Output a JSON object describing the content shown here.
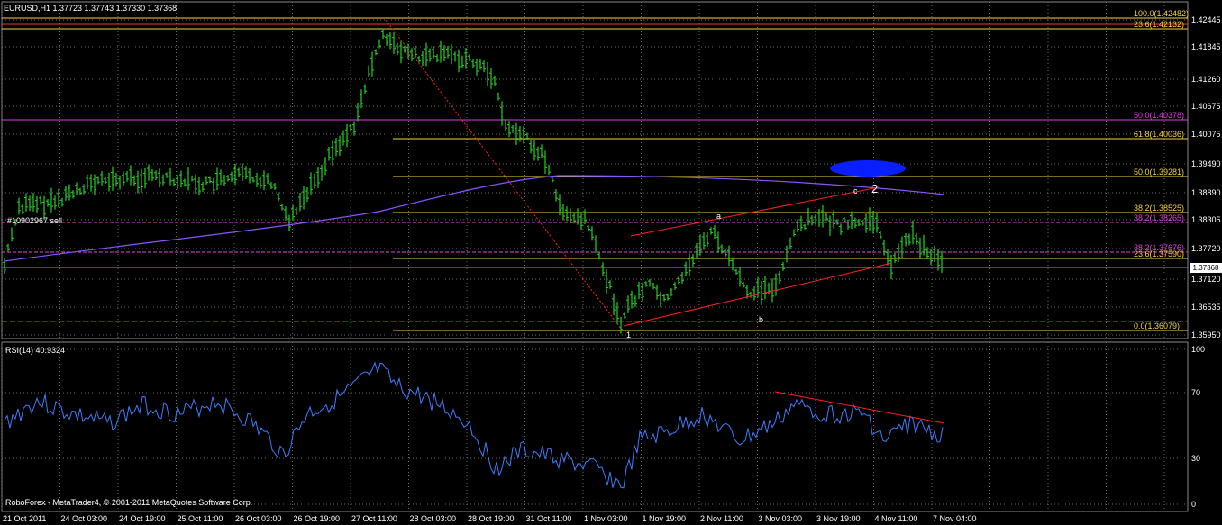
{
  "header": {
    "symbol_info": "EURUSD,H1  1.37723 1.37743 1.37330 1.37368"
  },
  "indicator": {
    "title": "RSI(14) 40.9324",
    "levels": [
      "100",
      "70",
      "30",
      "0"
    ]
  },
  "footer": {
    "copyright": "RoboForex - MetaTrader4, © 2001-2011 MetaQuotes Software Corp."
  },
  "order_label": "#10902967 sell",
  "current_price": "1.37368",
  "price_axis": [
    "1.42445",
    "1.41845",
    "1.41260",
    "1.40675",
    "1.40075",
    "1.39490",
    "1.38890",
    "1.38305",
    "1.37720",
    "1.37120",
    "1.36535",
    "1.35950"
  ],
  "time_axis": [
    "21 Oct 2011",
    "24 Oct 03:00",
    "24 Oct 19:00",
    "25 Oct 11:00",
    "26 Oct 03:00",
    "26 Oct 19:00",
    "27 Oct 11:00",
    "28 Oct 03:00",
    "28 Oct 19:00",
    "31 Oct 11:00",
    "1 Nov 03:00",
    "1 Nov 19:00",
    "2 Nov 11:00",
    "3 Nov 03:00",
    "3 Nov 19:00",
    "4 Nov 11:00",
    "7 Nov 04:00"
  ],
  "fib_levels": [
    {
      "label": "100.0(1.42482)",
      "color": "#f3d33a"
    },
    {
      "label": "23.6(1.42132)",
      "color": "#f3d33a"
    },
    {
      "label": "50.0(1.40378)",
      "color": "#e040e0"
    },
    {
      "label": "61.8(1.40036)",
      "color": "#f3d33a"
    },
    {
      "label": "50.0(1.39281)",
      "color": "#f3d33a"
    },
    {
      "label": "38.2(1.38525)",
      "color": "#f3d33a"
    },
    {
      "label": "38.2(1.38265)",
      "color": "#e040e0"
    },
    {
      "label": "38.2(1.37676)",
      "color": "#e040e0"
    },
    {
      "label": "23.6(1.37590)",
      "color": "#f3d33a"
    },
    {
      "label": "0.0(1.36079)",
      "color": "#f3d33a"
    }
  ],
  "wave_labels": {
    "one": "1",
    "two": "2",
    "a": "a",
    "b": "b",
    "c": "c"
  },
  "colors": {
    "candle": "#22d322",
    "grid": "#6a6a6a",
    "rsi": "#3e7dff",
    "ma": "#8a55ff",
    "trend": "#ff2020"
  }
}
